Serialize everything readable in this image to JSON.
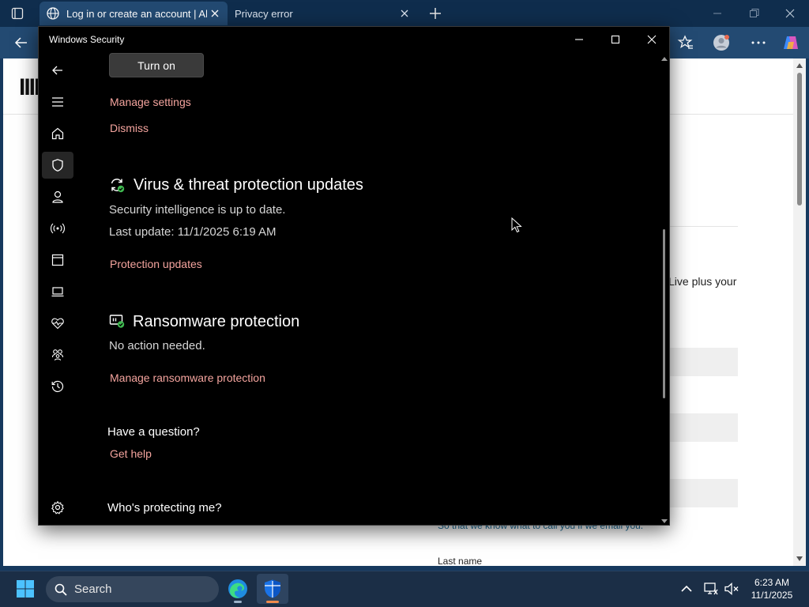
{
  "browser": {
    "tabs": [
      {
        "title": "Log in or create an account | Able",
        "active": true
      },
      {
        "title": "Privacy error",
        "active": false
      }
    ]
  },
  "webpage": {
    "logo_text": "IIII",
    "visible_text": "Live plus your",
    "helper_text": "So that we know what to call you if we email you.",
    "last_name_label": "Last name"
  },
  "security_window": {
    "title": "Windows Security",
    "accent_color": "#f4a49e",
    "turn_on_button": "Turn on",
    "manage_settings_link": "Manage settings",
    "dismiss_link": "Dismiss",
    "updates_section": {
      "heading": "Virus & threat protection updates",
      "status": "Security intelligence is up to date.",
      "last_update": "Last update: 11/1/2025 6:19 AM",
      "link": "Protection updates"
    },
    "ransomware_section": {
      "heading": "Ransomware protection",
      "status": "No action needed.",
      "link": "Manage ransomware protection"
    },
    "question_heading": "Have a question?",
    "get_help_link": "Get help",
    "protecting_heading": "Who's protecting me?"
  },
  "taskbar": {
    "search_label": "Search",
    "time": "6:23 AM",
    "date": "11/1/2025"
  }
}
